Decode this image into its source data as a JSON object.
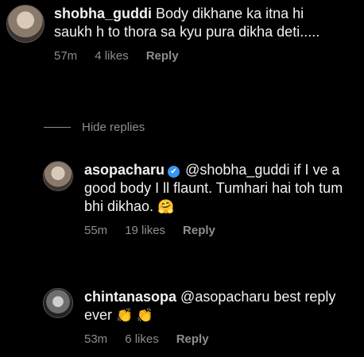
{
  "comments": [
    {
      "username": "shobha_guddi",
      "text": "Body dikhane ka itna hi saukh h to thora sa kyu pura dikha deti.....",
      "time": "57m",
      "likes": "4 likes",
      "reply_label": "Reply"
    },
    {
      "username": "asopacharu",
      "verified": true,
      "text": "@shobha_guddi if I ve a good body I ll flaunt. Tumhari hai toh tum bhi dikhao.",
      "emoji": "🤗",
      "time": "55m",
      "likes": "19 likes",
      "reply_label": "Reply"
    },
    {
      "username": "chintanasopa",
      "text": "@asopacharu best reply ever",
      "emoji": "👏 👏",
      "time": "53m",
      "likes": "6 likes",
      "reply_label": "Reply"
    }
  ],
  "hide_replies_label": "Hide replies",
  "icons": {
    "verified": "verified-badge-icon"
  },
  "colors": {
    "background": "#000000",
    "text": "#f1f1f1",
    "meta": "#8e8e8e",
    "verified": "#3897f0"
  }
}
